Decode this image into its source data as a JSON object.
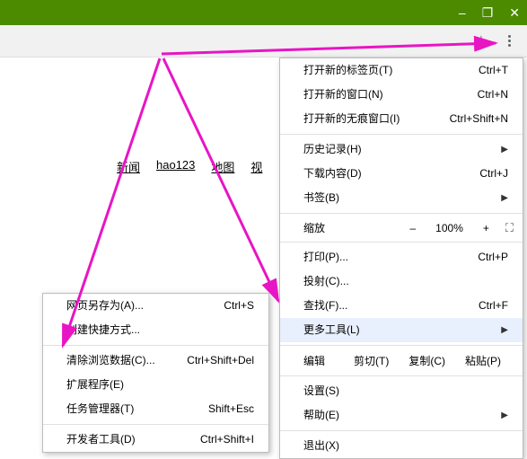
{
  "window": {
    "minimize": "–",
    "maximize": "❐",
    "close": "✕"
  },
  "toolbar": {
    "star": "☆"
  },
  "links": {
    "news": "新闻",
    "hao123": "hao123",
    "map": "地图",
    "video": "视"
  },
  "main_menu": {
    "new_tab": {
      "label": "打开新的标签页(T)",
      "shortcut": "Ctrl+T"
    },
    "new_window": {
      "label": "打开新的窗口(N)",
      "shortcut": "Ctrl+N"
    },
    "incognito": {
      "label": "打开新的无痕窗口(I)",
      "shortcut": "Ctrl+Shift+N"
    },
    "history": {
      "label": "历史记录(H)"
    },
    "downloads": {
      "label": "下载内容(D)",
      "shortcut": "Ctrl+J"
    },
    "bookmarks": {
      "label": "书签(B)"
    },
    "zoom": {
      "label": "缩放",
      "minus": "–",
      "pct": "100%",
      "plus": "+",
      "full": "⛶"
    },
    "print": {
      "label": "打印(P)...",
      "shortcut": "Ctrl+P"
    },
    "cast": {
      "label": "投射(C)..."
    },
    "find": {
      "label": "查找(F)...",
      "shortcut": "Ctrl+F"
    },
    "more_tools": {
      "label": "更多工具(L)"
    },
    "edit": {
      "label": "编辑",
      "cut": "剪切(T)",
      "copy": "复制(C)",
      "paste": "粘贴(P)"
    },
    "settings": {
      "label": "设置(S)"
    },
    "help": {
      "label": "帮助(E)"
    },
    "exit": {
      "label": "退出(X)"
    }
  },
  "sub_menu": {
    "save_as": {
      "label": "网页另存为(A)...",
      "shortcut": "Ctrl+S"
    },
    "shortcut": {
      "label": "创建快捷方式..."
    },
    "clear_data": {
      "label": "清除浏览数据(C)...",
      "shortcut": "Ctrl+Shift+Del"
    },
    "extensions": {
      "label": "扩展程序(E)"
    },
    "task_mgr": {
      "label": "任务管理器(T)",
      "shortcut": "Shift+Esc"
    },
    "dev_tools": {
      "label": "开发者工具(D)",
      "shortcut": "Ctrl+Shift+I"
    }
  }
}
